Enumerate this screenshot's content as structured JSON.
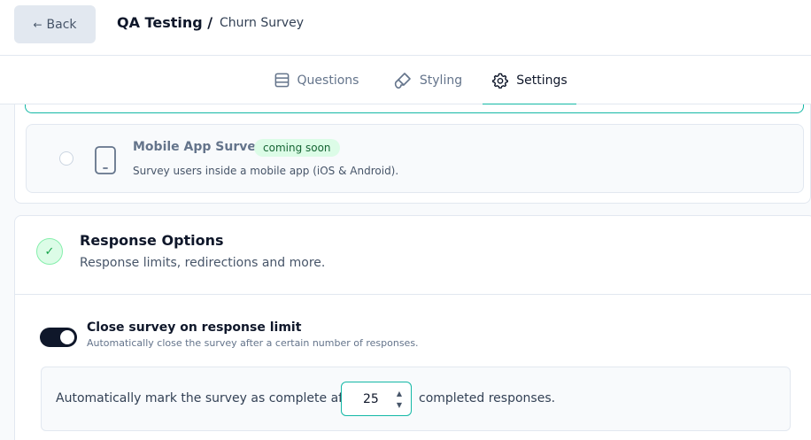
{
  "header": {
    "back_label": "Back",
    "project": "QA Testing /",
    "survey_name": "Churn Survey"
  },
  "tabs": [
    {
      "label": "Questions",
      "icon": "list-icon",
      "active": false
    },
    {
      "label": "Styling",
      "icon": "brush-icon",
      "active": false
    },
    {
      "label": "Settings",
      "icon": "gear-icon",
      "active": true
    }
  ],
  "survey_type": {
    "mobile": {
      "title": "Mobile App Survey",
      "badge": "coming soon",
      "description": "Survey users inside a mobile app (iOS & Android)."
    }
  },
  "response_options": {
    "title": "Response Options",
    "subtitle": "Response limits, redirections and more.",
    "close_on_limit": {
      "title": "Close survey on response limit",
      "description": "Automatically close the survey after a certain number of responses.",
      "enabled": true,
      "text_before": "Automatically mark the survey as complete after",
      "limit_value": "25",
      "text_after": "completed responses."
    }
  },
  "colors": {
    "accent": "#14b8a6",
    "dark": "#0f172a",
    "badge_bg": "#dcfce7"
  }
}
